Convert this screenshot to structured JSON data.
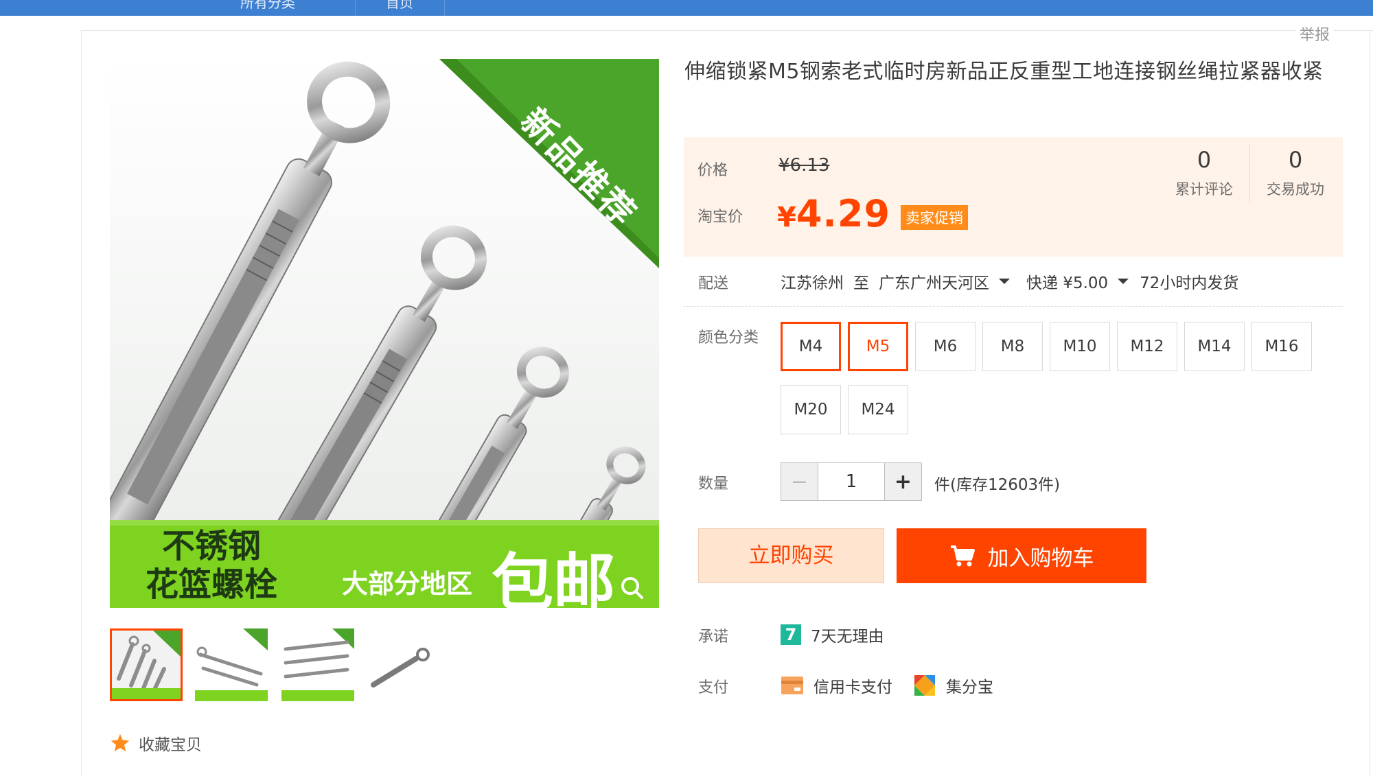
{
  "topbar": {
    "nav_left": "所有分类",
    "nav_right": "首页"
  },
  "report_label": "举报",
  "product": {
    "title": "伸缩锁紧M5钢索老式临时房新品正反重型工地连接钢丝绳拉紧器收紧",
    "image_overlay": {
      "corner_banner": "新品推荐",
      "bottom_left": "不锈钢\n花篮螺栓",
      "bottom_small": "大部分地区",
      "bottom_big": "包邮"
    }
  },
  "price": {
    "label": "价格",
    "original": "¥6.13",
    "taobao_label": "淘宝价",
    "currency": "¥",
    "current": "4.29",
    "promo_badge": "卖家促销"
  },
  "stats": {
    "reviews_count": "0",
    "reviews_label": "累计评论",
    "deals_count": "0",
    "deals_label": "交易成功"
  },
  "shipping": {
    "label": "配送",
    "from": "江苏徐州",
    "to_word": "至",
    "destination": "广东广州天河区",
    "method": "快递 ¥5.00",
    "dispatch": "72小时内发货"
  },
  "sku": {
    "label": "颜色分类",
    "options": [
      "M4",
      "M5",
      "M6",
      "M8",
      "M10",
      "M12",
      "M14",
      "M16",
      "M20",
      "M24"
    ]
  },
  "quantity": {
    "label": "数量",
    "minus": "−",
    "value": "1",
    "plus": "+",
    "stock": "件(库存12603件)"
  },
  "actions": {
    "buy_now": "立即购买",
    "add_to_cart": "加入购物车"
  },
  "promise": {
    "label": "承诺",
    "badge": "7",
    "text": "7天无理由"
  },
  "payment": {
    "label": "支付",
    "credit_card": "信用卡支付",
    "jifenbao": "集分宝"
  },
  "favorite": {
    "label": "收藏宝贝"
  },
  "colors": {
    "accent": "#ff4400",
    "topbar": "#3d7fd0",
    "price_bg": "#fff2e8",
    "promo": "#ff8c1a",
    "green_banner": "#7ed321"
  }
}
